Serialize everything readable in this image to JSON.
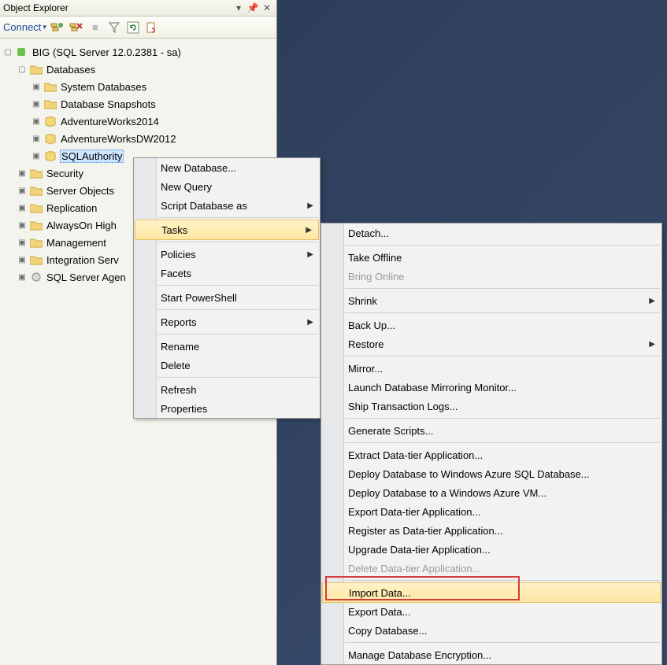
{
  "panel": {
    "title": "Object Explorer",
    "connect_label": "Connect"
  },
  "tree": {
    "root": "BIG (SQL Server 12.0.2381 - sa)",
    "databases": "Databases",
    "sys_db": "System Databases",
    "db_snap": "Database Snapshots",
    "aw2014": "AdventureWorks2014",
    "awdw2012": "AdventureWorksDW2012",
    "sqlauth": "SQLAuthority",
    "security": "Security",
    "server_obj": "Server Objects",
    "replication": "Replication",
    "alwayson": "AlwaysOn High",
    "management": "Management",
    "integration": "Integration Serv",
    "agent": "SQL Server Agen"
  },
  "menu1": {
    "new_db": "New Database...",
    "new_query": "New Query",
    "script_db": "Script Database as",
    "tasks": "Tasks",
    "policies": "Policies",
    "facets": "Facets",
    "powershell": "Start PowerShell",
    "reports": "Reports",
    "rename": "Rename",
    "delete": "Delete",
    "refresh": "Refresh",
    "properties": "Properties"
  },
  "menu2": {
    "detach": "Detach...",
    "take_offline": "Take Offline",
    "bring_online": "Bring Online",
    "shrink": "Shrink",
    "backup": "Back Up...",
    "restore": "Restore",
    "mirror": "Mirror...",
    "launch_mirror": "Launch Database Mirroring Monitor...",
    "ship_logs": "Ship Transaction Logs...",
    "gen_scripts": "Generate Scripts...",
    "extract_dt": "Extract Data-tier Application...",
    "deploy_azure_db": "Deploy Database to Windows Azure SQL Database...",
    "deploy_azure_vm": "Deploy Database to a Windows Azure VM...",
    "export_dt": "Export Data-tier Application...",
    "register_dt": "Register as Data-tier Application...",
    "upgrade_dt": "Upgrade Data-tier Application...",
    "delete_dt": "Delete Data-tier Application...",
    "import_data": "Import Data...",
    "export_data": "Export Data...",
    "copy_db": "Copy Database...",
    "manage_enc": "Manage Database Encryption..."
  }
}
